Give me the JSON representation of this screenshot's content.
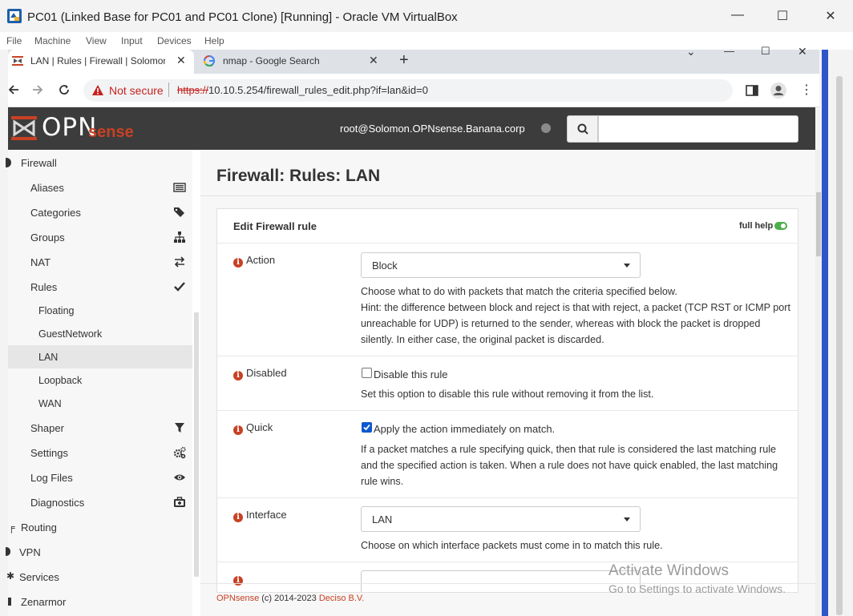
{
  "vbox": {
    "title": "PC01 (Linked Base for PC01 and PC01 Clone) [Running] - Oracle VM VirtualBox",
    "menu": [
      "File",
      "Machine",
      "View",
      "Input",
      "Devices",
      "Help"
    ]
  },
  "browser": {
    "tabs": [
      {
        "label": "LAN | Rules | Firewall | Solomon.O",
        "icon": "opnsense-favicon"
      },
      {
        "label": "nmap - Google Search",
        "icon": "google-favicon"
      }
    ],
    "not_secure": "Not secure",
    "url_scheme": "https://",
    "url_rest": "10.10.5.254/firewall_rules_edit.php?if=lan&id=0"
  },
  "header": {
    "logo_part1": "OPN",
    "logo_part2": "sense",
    "user": "root@Solomon.OPNsense.Banana.corp",
    "search_placeholder": ""
  },
  "sidebar": {
    "firewall": "Firewall",
    "items": [
      {
        "label": "Aliases",
        "icon": "list-icon"
      },
      {
        "label": "Categories",
        "icon": "tags-icon"
      },
      {
        "label": "Groups",
        "icon": "sitemap-icon"
      },
      {
        "label": "NAT",
        "icon": "exchange-icon"
      },
      {
        "label": "Rules",
        "icon": "check-icon"
      }
    ],
    "subitems": [
      "Floating",
      "GuestNetwork",
      "LAN",
      "Loopback",
      "WAN"
    ],
    "items2": [
      {
        "label": "Shaper",
        "icon": "filter-icon"
      },
      {
        "label": "Settings",
        "icon": "cogs-icon"
      },
      {
        "label": "Log Files",
        "icon": "eye-icon"
      },
      {
        "label": "Diagnostics",
        "icon": "medkit-icon"
      }
    ],
    "top": [
      "Routing",
      "VPN",
      "Services",
      "Zenarmor"
    ]
  },
  "page": {
    "title": "Firewall: Rules: LAN",
    "panel_title": "Edit Firewall rule",
    "full_help": "full help"
  },
  "form": {
    "action": {
      "label": "Action",
      "value": "Block",
      "help1": "Choose what to do with packets that match the criteria specified below.",
      "help2": "Hint: the difference between block and reject is that with reject, a packet (TCP RST or ICMP port unreachable for UDP) is returned to the sender, whereas with block the packet is dropped silently. In either case, the original packet is discarded."
    },
    "disabled": {
      "label": "Disabled",
      "checkbox": "Disable this rule",
      "checked": false,
      "help": "Set this option to disable this rule without removing it from the list."
    },
    "quick": {
      "label": "Quick",
      "checkbox": "Apply the action immediately on match.",
      "checked": true,
      "help": "If a packet matches a rule specifying quick, then that rule is considered the last matching rule and the specified action is taken. When a rule does not have quick enabled, the last matching rule wins."
    },
    "interface": {
      "label": "Interface",
      "value": "LAN",
      "help": "Choose on which interface packets must come in to match this rule."
    }
  },
  "footer": {
    "brand": "OPNsense",
    "copyright": "(c) 2014-2023",
    "company": "Deciso B.V."
  },
  "watermark": {
    "line1": "Activate Windows",
    "line2": "Go to Settings to activate Windows."
  }
}
